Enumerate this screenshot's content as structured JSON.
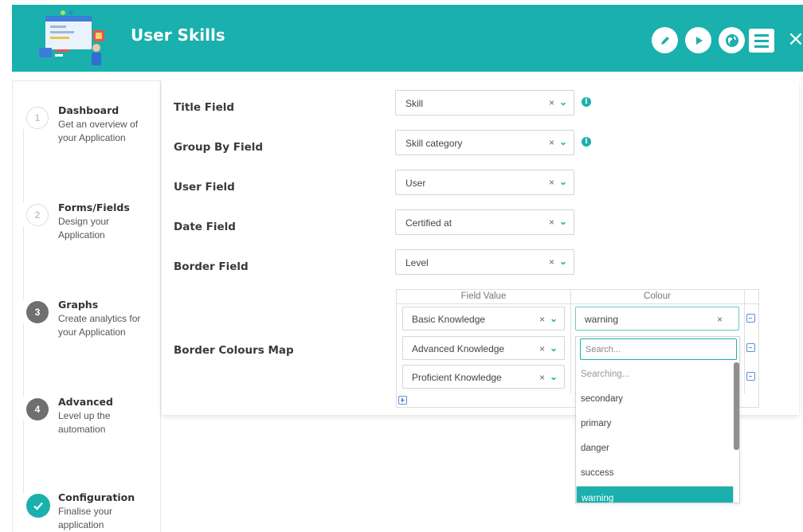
{
  "header": {
    "title": "User Skills",
    "bg_color": "#19b0ad",
    "actions": [
      {
        "icon": "pencil-icon"
      },
      {
        "icon": "play-icon"
      },
      {
        "icon": "globe-icon"
      },
      {
        "icon": "menu-icon"
      },
      {
        "icon": "close-icon",
        "label": "×"
      }
    ]
  },
  "sidebar": {
    "steps": [
      {
        "number": "1",
        "title": "Dashboard",
        "desc": "Get an overview of your Application",
        "state": "todo"
      },
      {
        "number": "2",
        "title": "Forms/Fields",
        "desc": "Design your Application",
        "state": "todo"
      },
      {
        "number": "3",
        "title": "Graphs",
        "desc": "Create analytics for your Application",
        "state": "current"
      },
      {
        "number": "4",
        "title": "Advanced",
        "desc": "Level up the automation",
        "state": "current"
      },
      {
        "number": "✓",
        "title": "Configuration",
        "desc": "Finalise your application",
        "state": "done"
      }
    ]
  },
  "form": {
    "fields": [
      {
        "label": "Title Field",
        "value": "Skill",
        "info": true
      },
      {
        "label": "Group By Field",
        "value": "Skill category",
        "info": true
      },
      {
        "label": "User Field",
        "value": "User",
        "info": false
      },
      {
        "label": "Date Field",
        "value": "Certified at",
        "info": false
      },
      {
        "label": "Border Field",
        "value": "Level",
        "info": false
      }
    ],
    "clear": "×",
    "chevron": "⌄",
    "info_glyph": "i",
    "border_map": {
      "label": "Border Colours Map",
      "headers": [
        "Field Value",
        "Colour"
      ],
      "rows": [
        {
          "field_value": "Basic Knowledge",
          "colour": "warning"
        },
        {
          "field_value": "Advanced Knowledge",
          "colour": ""
        },
        {
          "field_value": "Proficient Knowledge",
          "colour": ""
        }
      ]
    }
  },
  "dropdown": {
    "search_placeholder": "Search...",
    "options": [
      "Searching...",
      "secondary",
      "primary",
      "danger",
      "success",
      "warning"
    ],
    "selected": "warning"
  }
}
